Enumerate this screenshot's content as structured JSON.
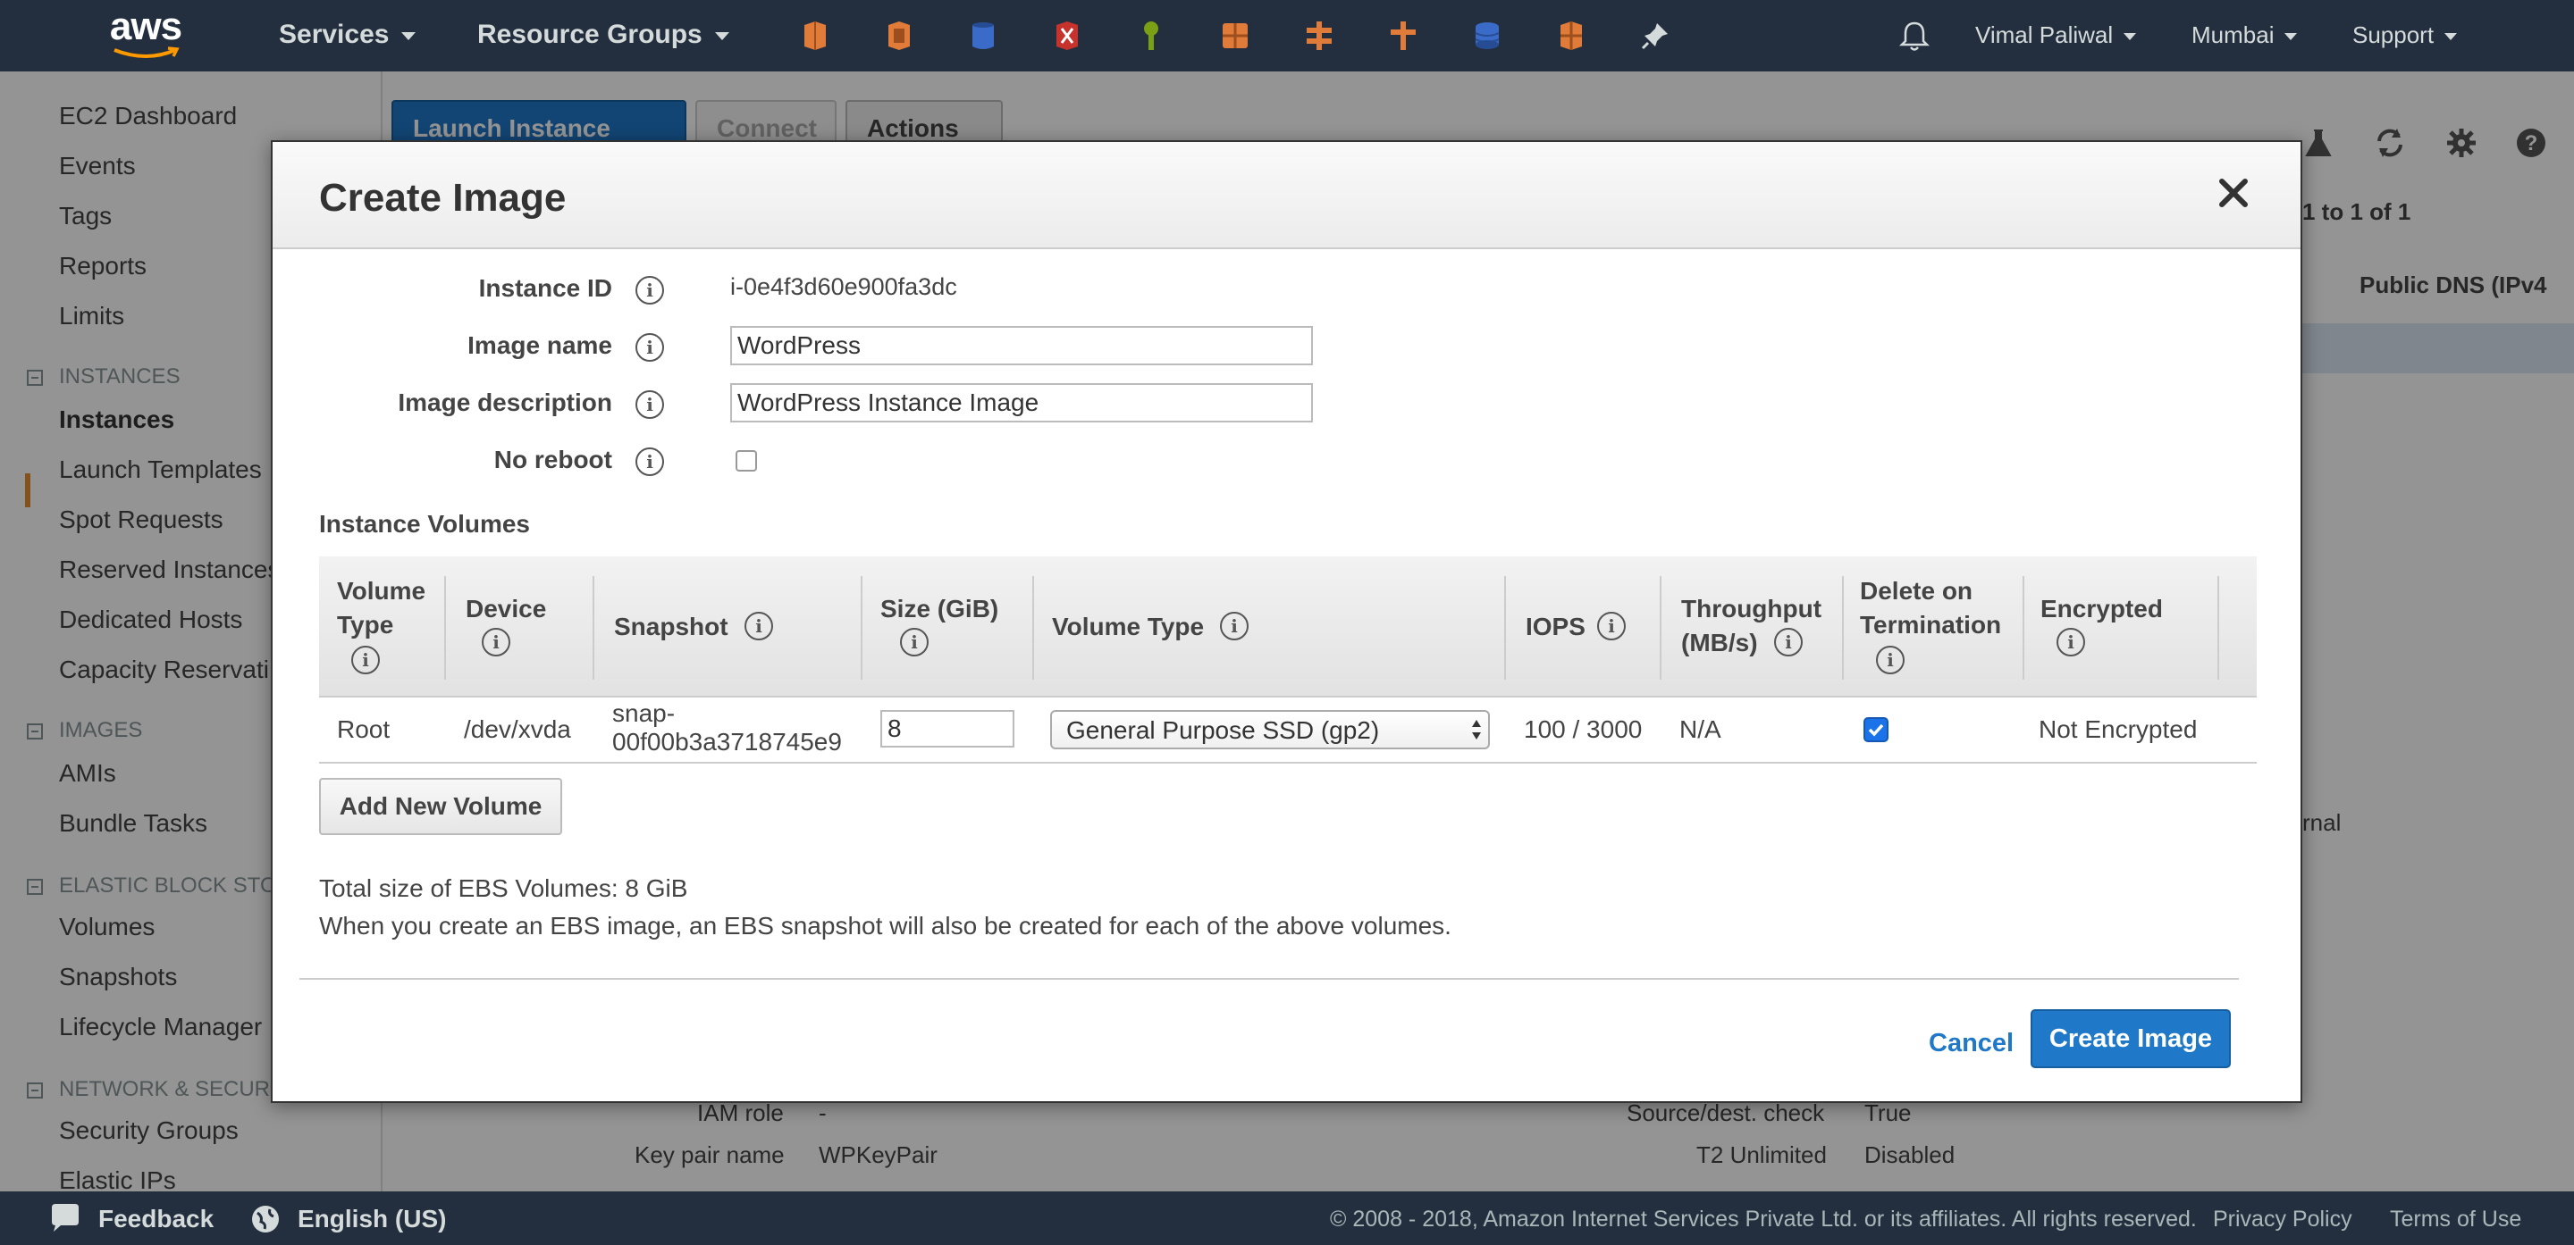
{
  "topnav": {
    "logo_text": "aws",
    "services_label": "Services",
    "resource_groups_label": "Resource Groups",
    "user_label": "Vimal Paliwal",
    "region_label": "Mumbai",
    "support_label": "Support"
  },
  "sidebar": {
    "items": {
      "ec2_dashboard": "EC2 Dashboard",
      "events": "Events",
      "tags": "Tags",
      "reports": "Reports",
      "limits": "Limits",
      "instances_section": "INSTANCES",
      "instances": "Instances",
      "launch_templates": "Launch Templates",
      "spot_requests": "Spot Requests",
      "reserved_instances": "Reserved Instances",
      "dedicated_hosts": "Dedicated Hosts",
      "capacity_reservations": "Capacity Reservati",
      "images_section": "IMAGES",
      "amis": "AMIs",
      "bundle_tasks": "Bundle Tasks",
      "ebs_section": "ELASTIC BLOCK STO",
      "volumes": "Volumes",
      "snapshots": "Snapshots",
      "lifecycle_manager": "Lifecycle Manager",
      "network_section": "NETWORK & SECURI",
      "security_groups": "Security Groups",
      "elastic_ips": "Elastic IPs"
    }
  },
  "background": {
    "launch_instance_label": "Launch Instance",
    "connect_label": "Connect",
    "actions_label": "Actions",
    "pagination_text": "1 to 1 of 1",
    "public_dns_header": "Public DNS (IPv4",
    "internal_fragment": "rnal",
    "iam_role_label": "IAM role",
    "iam_role_value": "-",
    "key_pair_label": "Key pair name",
    "key_pair_value": "WPKeyPair",
    "source_dest_label": "Source/dest. check",
    "source_dest_value": "True",
    "t2_unlimited_label": "T2 Unlimited",
    "t2_unlimited_value": "Disabled"
  },
  "modal": {
    "title": "Create Image",
    "fields": {
      "instance_id_label": "Instance ID",
      "instance_id_value": "i-0e4f3d60e900fa3dc",
      "image_name_label": "Image name",
      "image_name_value": "WordPress",
      "image_description_label": "Image description",
      "image_description_value": "WordPress Instance Image",
      "no_reboot_label": "No reboot"
    },
    "volumes": {
      "section_title": "Instance Volumes",
      "headers": {
        "volume_type_line1": "Volume",
        "volume_type_line2": "Type",
        "device": "Device",
        "snapshot": "Snapshot",
        "size": "Size (GiB)",
        "volume_type": "Volume Type",
        "iops": "IOPS",
        "throughput_line1": "Throughput",
        "throughput_line2": "(MB/s)",
        "delete_line1": "Delete on",
        "delete_line2": "Termination",
        "encrypted": "Encrypted"
      },
      "row": {
        "type": "Root",
        "device": "/dev/xvda",
        "snapshot_line1": "snap-",
        "snapshot_line2": "00f00b3a3718745e9",
        "size": "8",
        "volume_type": "General Purpose SSD (gp2)",
        "iops": "100 / 3000",
        "throughput": "N/A",
        "delete_on_termination": true,
        "encrypted": "Not Encrypted"
      },
      "add_button_label": "Add New Volume"
    },
    "total_size_text": "Total size of EBS Volumes: 8 GiB",
    "snapshot_note": "When you create an EBS image, an EBS snapshot will also be created for each of the above volumes.",
    "cancel_label": "Cancel",
    "create_label": "Create Image"
  },
  "footer": {
    "feedback_label": "Feedback",
    "language_label": "English (US)",
    "copyright": "© 2008 - 2018, Amazon Internet Services Private Ltd. or its affiliates. All rights reserved.",
    "privacy_label": "Privacy Policy",
    "terms_label": "Terms of Use"
  },
  "colors": {
    "nav_bg": "#232f3e",
    "accent_blue": "#1f78c8",
    "active_orange": "#e48f32"
  }
}
